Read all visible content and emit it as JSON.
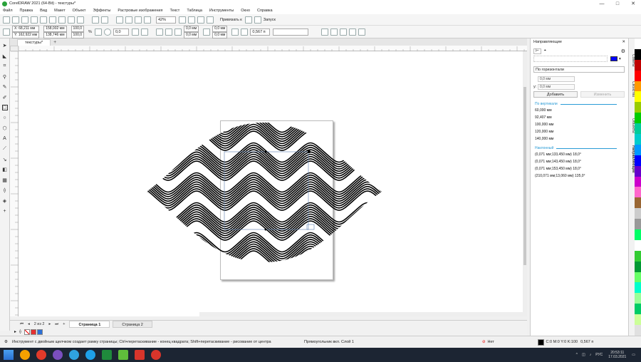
{
  "window": {
    "title": "CorelDRAW 2021 (64-Bit) - текстуры*",
    "minimize": "—",
    "maximize": "□",
    "close": "✕"
  },
  "menu": [
    "Файл",
    "Правка",
    "Вид",
    "Макет",
    "Объект",
    "Эффекты",
    "Растровые изображения",
    "Текст",
    "Таблица",
    "Инструменты",
    "Окно",
    "Справка"
  ],
  "std_toolbar": {
    "zoom": "42%",
    "snap_label": "Привязать к",
    "launch_label": "Запуск"
  },
  "propbar": {
    "x": "X: 68,211 мм",
    "y": "Y: 162,922 мм",
    "w": "158,002 мм",
    "h": "138,746 мм",
    "sx": "100,0",
    "sy": "100,0",
    "pct": "%",
    "angle": "0,0",
    "off1": "0,0 мм",
    "off2": "0,0 мм",
    "nx": "0,0 мм",
    "ny": "0,0 мм",
    "outline": "0,567 п"
  },
  "doc_tab": "текстуры*",
  "page_nav": {
    "counter": "2 из 2",
    "tabs": [
      "Страница 1",
      "Страница 2"
    ]
  },
  "status": {
    "hint": "Инструмент с двойным щелчком создает рамку страницы; Ctrl+перетаскивание - конец квадрата; Shift+перетаскивание - рисование от центра",
    "object": "Прямоугольник вкл. Слой 1",
    "fill": "Нет",
    "color_info": "C:0 M:0 Y:0 K:100",
    "outline": "0,567 п"
  },
  "docker": {
    "title": "Направляющие",
    "orientation": "По горизонтали",
    "x_field": "0,0 мм",
    "y_field": "0,0 мм",
    "add_button": "Добавить",
    "replace_button": "Изменить",
    "vertical_header": "По вертикали",
    "vertical_items": [
      "60,000 мм",
      "92,407 мм",
      "100,000 мм",
      "120,000 мм",
      "140,000 мм"
    ],
    "slanted_header": "Наклонный",
    "slanted_items": [
      "(0,071 мм;133,450 мм) 18,0°",
      "(0,071 мм;143,450 мм) 18,0°",
      "(0,071 мм;153,450 мм) 18,0°",
      "(210,071 мм;13,060 мм) 135,0°"
    ]
  },
  "side_tabs": [
    "Советы",
    "Свойства",
    "Объекты",
    "Направляющие"
  ],
  "taskbar": {
    "lang": "РУС",
    "time": "20:53:11",
    "date": "17.03.2021"
  },
  "colors": {
    "accent": "#2a9bd6",
    "guide_color": "#0000ff"
  }
}
